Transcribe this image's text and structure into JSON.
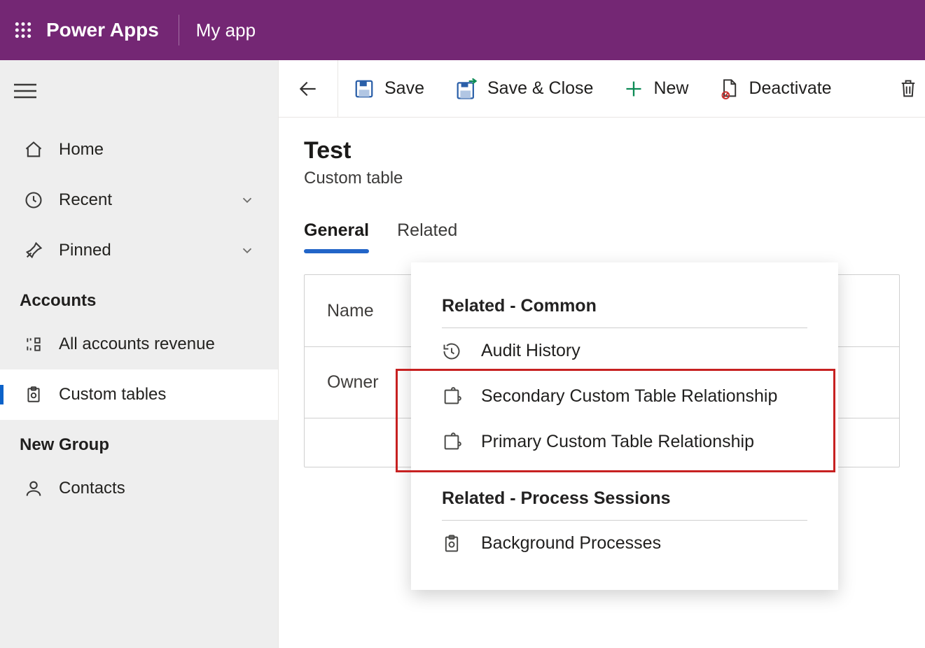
{
  "header": {
    "brand": "Power Apps",
    "env": "My app"
  },
  "sidebar": {
    "items": [
      {
        "label": "Home"
      },
      {
        "label": "Recent"
      },
      {
        "label": "Pinned"
      }
    ],
    "section1": "Accounts",
    "account_items": [
      {
        "label": "All accounts revenue"
      },
      {
        "label": "Custom tables"
      }
    ],
    "section2": "New Group",
    "group_items": [
      {
        "label": "Contacts"
      }
    ]
  },
  "commands": {
    "save": "Save",
    "save_close": "Save & Close",
    "new": "New",
    "deactivate": "Deactivate"
  },
  "page": {
    "title": "Test",
    "subtitle": "Custom table"
  },
  "tabs": {
    "general": "General",
    "related": "Related"
  },
  "form": {
    "name_label": "Name",
    "owner_label": "Owner"
  },
  "related_menu": {
    "group1_title": "Related - Common",
    "items1": [
      {
        "label": "Audit History"
      },
      {
        "label": "Secondary Custom Table Relationship"
      },
      {
        "label": "Primary Custom Table Relationship"
      }
    ],
    "group2_title": "Related - Process Sessions",
    "items2": [
      {
        "label": "Background Processes"
      }
    ]
  }
}
